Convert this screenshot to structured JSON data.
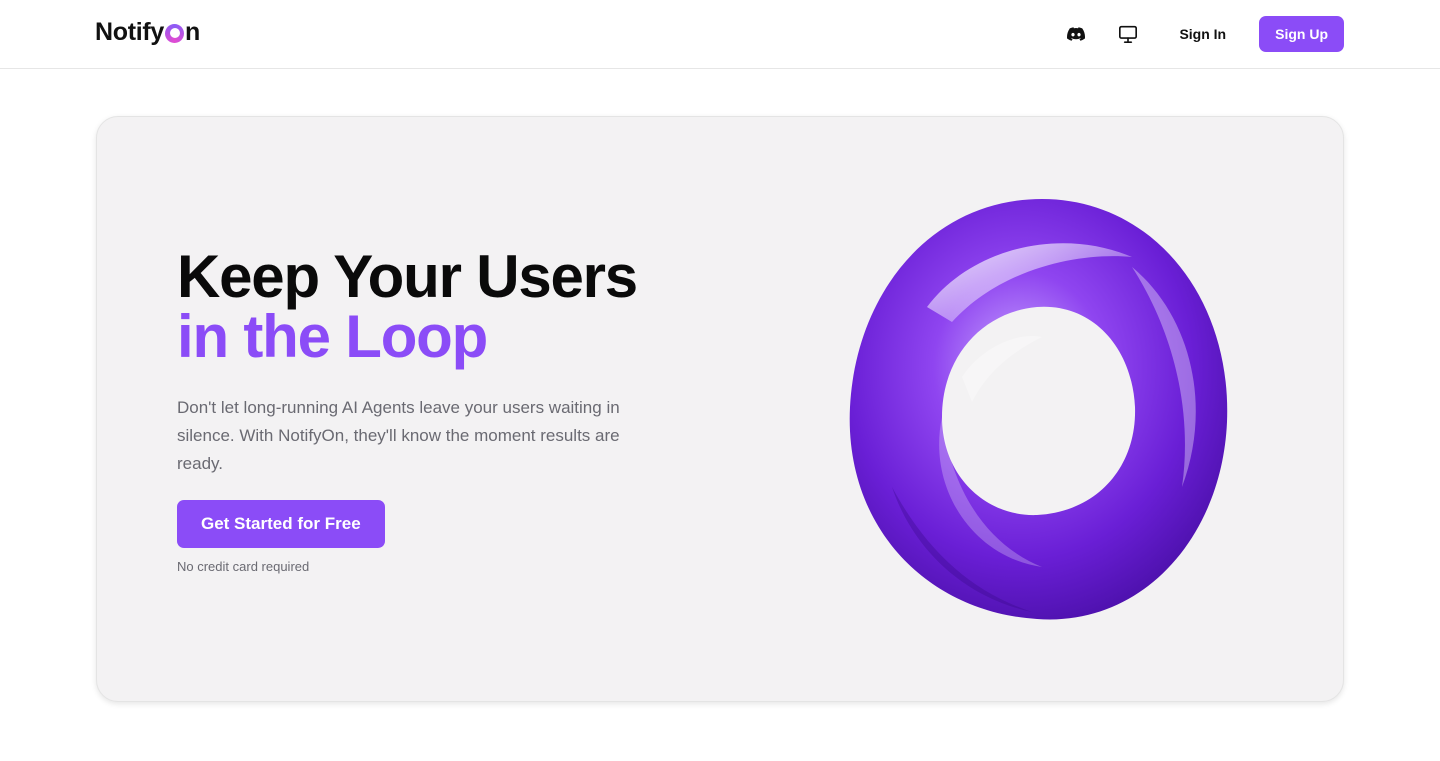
{
  "nav": {
    "logo_text_before": "Notify",
    "logo_text_after": "n",
    "discord_icon": "discord-icon",
    "monitor_icon": "monitor-icon",
    "sign_in": "Sign In",
    "sign_up": "Sign Up"
  },
  "hero": {
    "headline_line1": "Keep Your Users",
    "headline_line2": "in the Loop",
    "subtitle": "Don't let long-running AI Agents leave your users waiting in silence. With NotifyOn, they'll know the moment results are ready.",
    "cta_label": "Get Started for Free",
    "cta_note": "No credit card required"
  },
  "colors": {
    "accent": "#8b4cf7",
    "card_bg": "#f3f2f3",
    "muted_text": "#6a6a72"
  }
}
